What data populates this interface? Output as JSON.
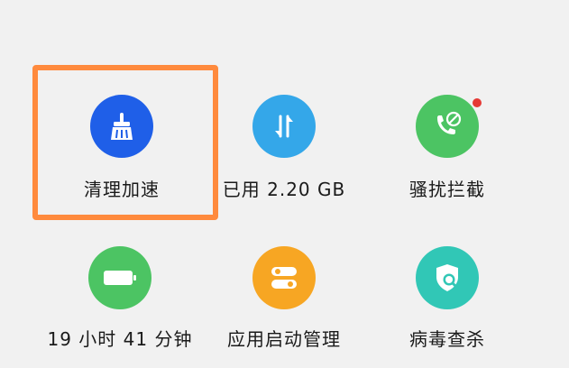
{
  "tiles": [
    {
      "label": "清理加速",
      "icon": "broom-clean-icon",
      "color": "#1f5fe8"
    },
    {
      "label": "已用 2.20 GB",
      "icon": "data-usage-arrows-icon",
      "color": "#34a7e9"
    },
    {
      "label": "骚扰拦截",
      "icon": "phone-block-icon",
      "color": "#4cc463",
      "badge": true
    },
    {
      "label": "19 小时 41 分钟",
      "icon": "battery-icon",
      "color": "#4cc463"
    },
    {
      "label": "应用启动管理",
      "icon": "app-launch-toggle-icon",
      "color": "#f7a623"
    },
    {
      "label": "病毒查杀",
      "icon": "shield-scan-icon",
      "color": "#31c7b6"
    }
  ],
  "highlight": {
    "color": "#ff8a3d"
  }
}
